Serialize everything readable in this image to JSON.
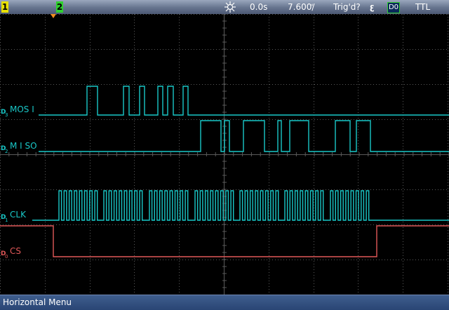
{
  "topbar": {
    "channel1_label": "1",
    "channel2_label": "2",
    "horizontal_position": "0.0s",
    "vertical_scale": "7.600ꜗ/",
    "trigger_status": "Trig'd?",
    "trigger_slope_symbol": "ꜫ",
    "trigger_source": "D0",
    "threshold_label": "TTL"
  },
  "traces": [
    {
      "id": "D3",
      "name": "MOSI",
      "label": "MOS I",
      "color": "#19c8c8"
    },
    {
      "id": "D2",
      "name": "MISO",
      "label": "M I SO",
      "color": "#19c8c8"
    },
    {
      "id": "D1",
      "name": "CLK",
      "label": "CLK",
      "color": "#19c8c8"
    },
    {
      "id": "D0",
      "name": "CS",
      "label": "CS",
      "color": "#e05858"
    }
  ],
  "bottombar": {
    "menu_title": "Horizontal Menu"
  },
  "colors": {
    "digital_trace": "#19c8c8",
    "cs_trace": "#e05858",
    "grid": "#5a5a5a",
    "trigger_marker": "#f08c1e"
  }
}
